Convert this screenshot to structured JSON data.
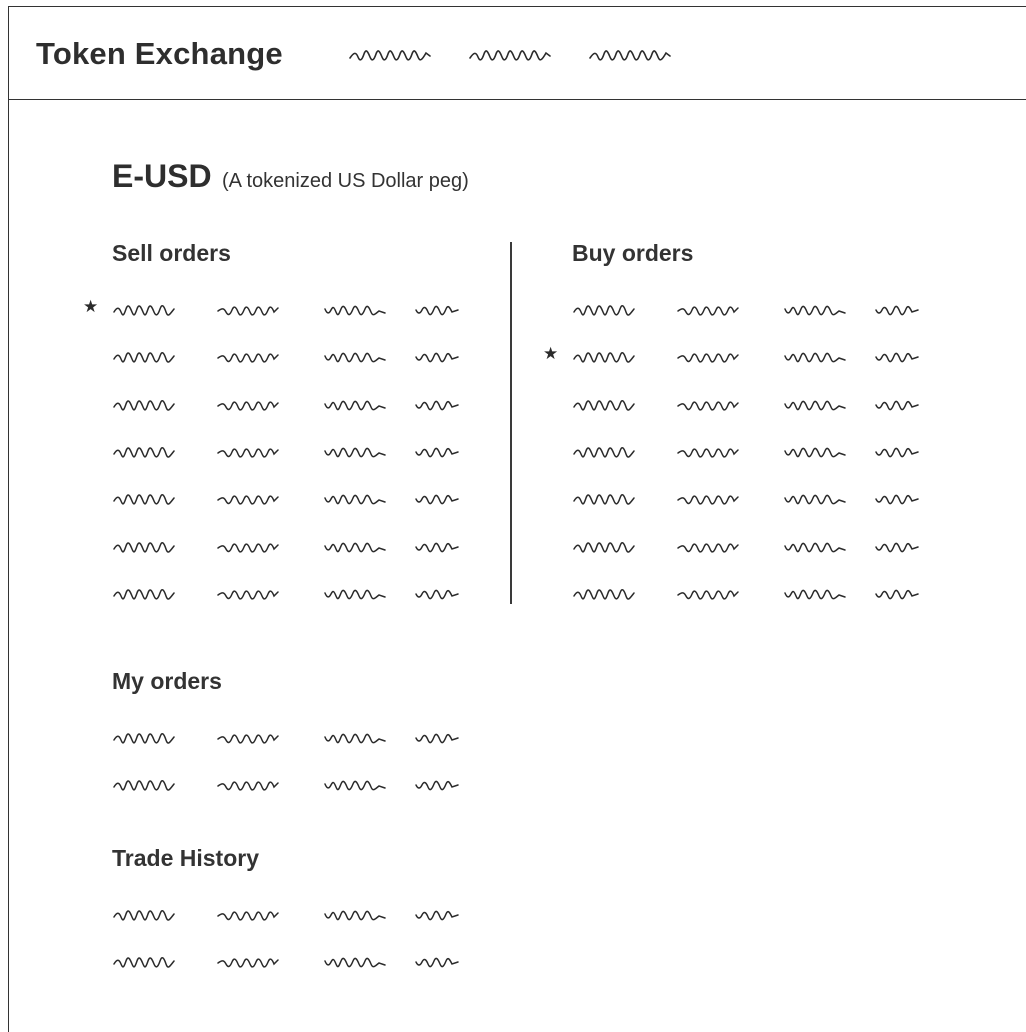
{
  "app": {
    "title": "Token Exchange",
    "nav": [
      {
        "label": "",
        "placeholder": "scribble"
      },
      {
        "label": "",
        "placeholder": "scribble"
      },
      {
        "label": "",
        "placeholder": "scribble"
      }
    ]
  },
  "asset": {
    "symbol": "E-USD",
    "description": "(A tokenized US Dollar peg)"
  },
  "sections": {
    "sell_orders": {
      "title": "Sell orders",
      "rows": 7,
      "starred_row": 0
    },
    "buy_orders": {
      "title": "Buy orders",
      "rows": 7,
      "starred_row": 1
    },
    "my_orders": {
      "title": "My orders",
      "rows": 2
    },
    "trade_history": {
      "title": "Trade History",
      "rows": 2
    }
  },
  "icons": {
    "star": "star-icon"
  },
  "colors": {
    "ink": "#2b2b2b",
    "border": "#333333",
    "background": "#ffffff"
  }
}
